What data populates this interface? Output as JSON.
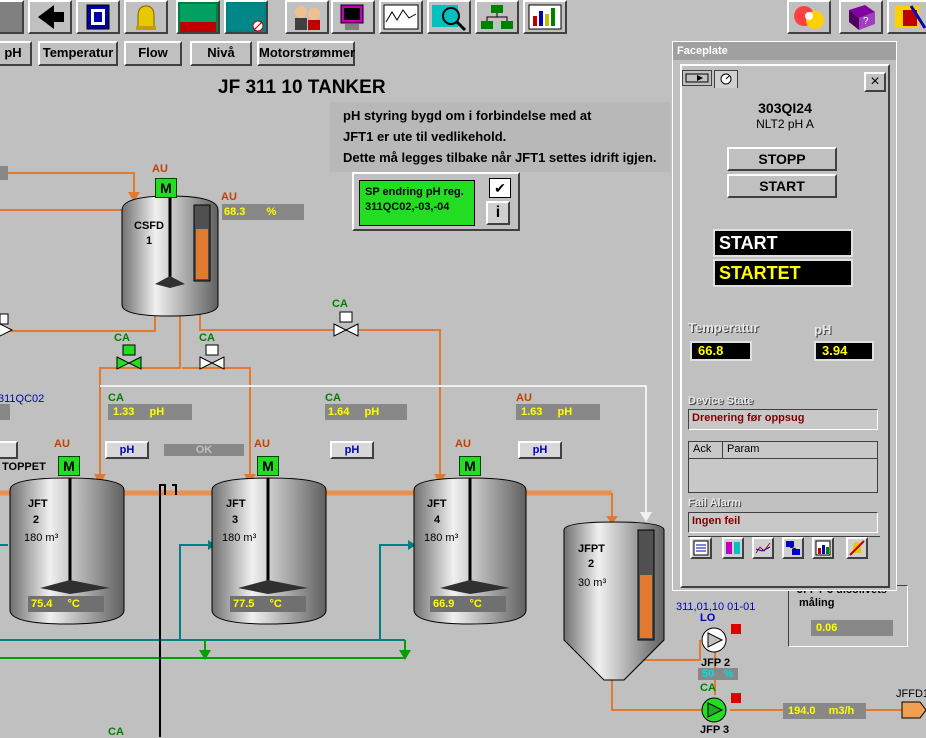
{
  "nav": {
    "ph": "pH",
    "temperatur": "Temperatur",
    "flow": "Flow",
    "niva": "Nivå",
    "motor": "Motorstrømmer"
  },
  "title": "JF 311 10 TANKER",
  "notice": [
    "pH styring bygd om i forbindelse med at",
    "JFT1 er ute til vedlikehold.",
    "Dette må legges tilbake når JFT1 settes idrift igjen."
  ],
  "sp": {
    "line1": "SP endring pH reg.",
    "line2": "311QC02,-03,-04",
    "check": "✔",
    "info": "i"
  },
  "csfd": {
    "name": "CSFD",
    "num": "1",
    "motor_mode": "AU",
    "level_mode": "AU",
    "level": "68.3",
    "unit": "%"
  },
  "valves": {
    "v1": "CA",
    "v2": "CA",
    "v3": "CA"
  },
  "left_tag": "311QC02",
  "toppet": "TOPPET",
  "ok": "OK",
  "tanks": [
    {
      "name": "JFT",
      "num": "2",
      "vol": "180 m³",
      "temp": "75.4",
      "tunit": "°C",
      "ph_mode": "CA",
      "ph": "1.33",
      "ph_unit": "pH",
      "motor": "AU"
    },
    {
      "name": "JFT",
      "num": "3",
      "vol": "180 m³",
      "temp": "77.5",
      "tunit": "°C",
      "ph_mode": "CA",
      "ph": "1.64",
      "ph_unit": "pH",
      "motor": "AU"
    },
    {
      "name": "JFT",
      "num": "4",
      "vol": "180 m³",
      "temp": "66.9",
      "tunit": "°C",
      "ph_mode": "AU",
      "ph": "1.63",
      "ph_unit": "pH",
      "motor": "AU"
    }
  ],
  "ph_btn": "pH",
  "motor_m": "M",
  "jfpt": {
    "name": "JFPT",
    "num": "2",
    "vol": "30 m³"
  },
  "pumps": {
    "tag": "311,01,10 01-01",
    "p2_mode": "LO",
    "p2_name": "JFP 2",
    "p2_val": "50",
    "p2_unit": "%",
    "p3_mode": "CA",
    "p3_name": "JFP 3"
  },
  "flow": {
    "value": "194.0",
    "unit": "m3/h",
    "dest": "JFFD1"
  },
  "measure": {
    "line1": "JFPT 3 ulcollvets",
    "line2": "måling",
    "value": "0.06"
  },
  "bottom_ca": "CA",
  "faceplate": {
    "window_title": "Faceplate",
    "close": "×",
    "tag": "303QI24",
    "desc": "NLT2 pH A",
    "stop": "STOPP",
    "start": "START",
    "state1": "START",
    "state2": "STARTET",
    "temp_label": "Temperatur",
    "temp_value": "66.8",
    "ph_label": "pH",
    "ph_value": "3.94",
    "device_state_label": "Device State",
    "device_state": "Drenering før oppsug",
    "ack": "Ack",
    "param": "Param",
    "fail_label": "Fail Alarm",
    "fail_value": "Ingen feil"
  },
  "colors": {
    "pipe_orange": "#e07a30",
    "pipe_teal": "#008080",
    "pipe_green": "#00a000",
    "motor_green": "#22dd22",
    "value_yellow": "#ffff00"
  }
}
